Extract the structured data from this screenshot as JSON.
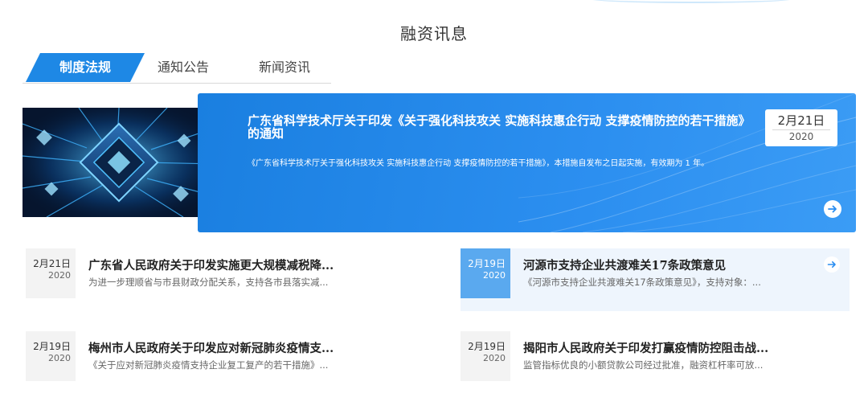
{
  "section": {
    "title": "融资讯息"
  },
  "tabs": [
    {
      "label": "制度法规",
      "active": true
    },
    {
      "label": "通知公告",
      "active": false
    },
    {
      "label": "新闻资讯",
      "active": false
    }
  ],
  "featured": {
    "title": "广东省科学技术厅关于印发《关于强化科技攻关 实施科技惠企行动 支撑疫情防控的若干措施》的通知",
    "desc": "《广东省科学技术厅关于强化科技攻关 实施科技惠企行动 支撑疫情防控的若干措施》，本措施自发布之日起实施，有效期为 1 年。",
    "date": "2月21日",
    "year": "2020",
    "arrow_icon": "arrow-right-circle-icon"
  },
  "news": [
    {
      "date": "2月21日",
      "year": "2020",
      "title": "广东省人民政府关于印发实施更大规模减税降...",
      "desc": "为进一步理顺省与市县财政分配关系，支持各市县落实减..."
    },
    {
      "date": "2月19日",
      "year": "2020",
      "title": "河源市支持企业共渡难关17条政策意见",
      "desc": "《河源市支持企业共渡难关17条政策意见》，支持对象：...",
      "highlighted": true
    },
    {
      "date": "2月19日",
      "year": "2020",
      "title": "梅州市人民政府关于印发应对新冠肺炎疫情支...",
      "desc": "《关于应对新冠肺炎疫情支持企业复工复产的若干措施》..."
    },
    {
      "date": "2月19日",
      "year": "2020",
      "title": "揭阳市人民政府关于印发打赢疫情防控阻击战...",
      "desc": "监管指标优良的小额贷款公司经过批准，融资杠杆率可放..."
    }
  ],
  "colors": {
    "accent": "#1e88e5",
    "highlight_bg": "#eef5fd",
    "highlight_date": "#5aa9ef"
  }
}
